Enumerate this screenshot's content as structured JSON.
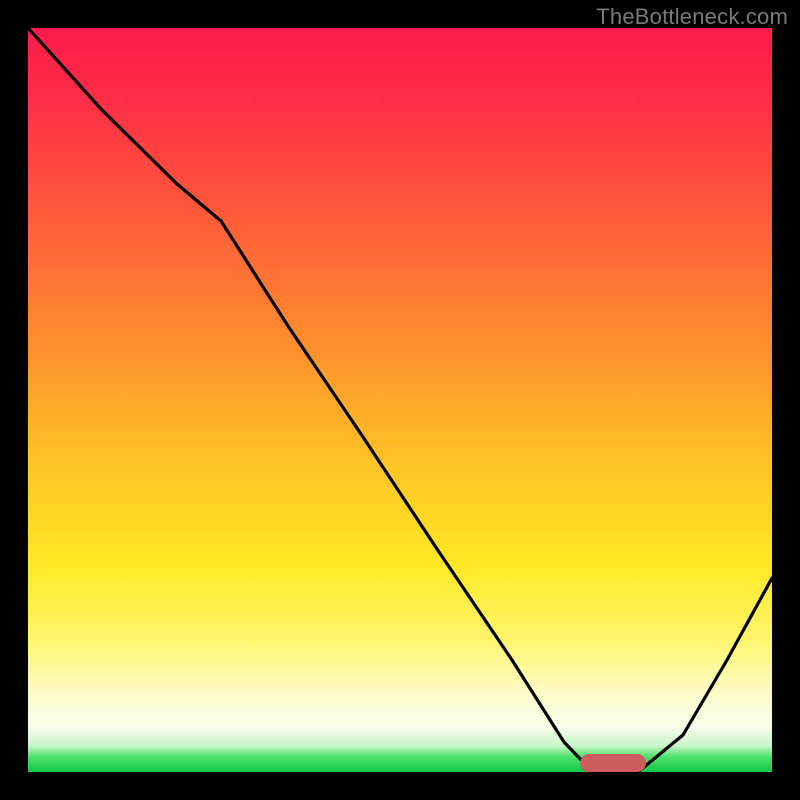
{
  "watermark": "TheBottleneck.com",
  "colors": {
    "frame": "#000000",
    "curve": "#000000",
    "marker": "#ce5b5d",
    "gradient_top": "#ff1a4b",
    "gradient_bottom": "#14c84a"
  },
  "chart_data": {
    "type": "line",
    "title": "",
    "xlabel": "",
    "ylabel": "",
    "xlim": [
      0,
      100
    ],
    "ylim": [
      0,
      100
    ],
    "x": [
      0,
      10,
      20,
      26,
      35,
      45,
      55,
      65,
      72,
      75,
      79,
      82,
      88,
      94,
      100
    ],
    "values": [
      100,
      89,
      79,
      74,
      60,
      45,
      30,
      15,
      4,
      1,
      0,
      0,
      5,
      15,
      26
    ],
    "marker": {
      "x_start": 74,
      "x_end": 82,
      "y": 0
    },
    "notes": "Y represents vertical position from bottom (0) to top (100). Curve starts at top-left, descends with a slope change around x≈26, reaches zero near x≈79–82 (flat minimum with marker), then rises toward x=100."
  }
}
